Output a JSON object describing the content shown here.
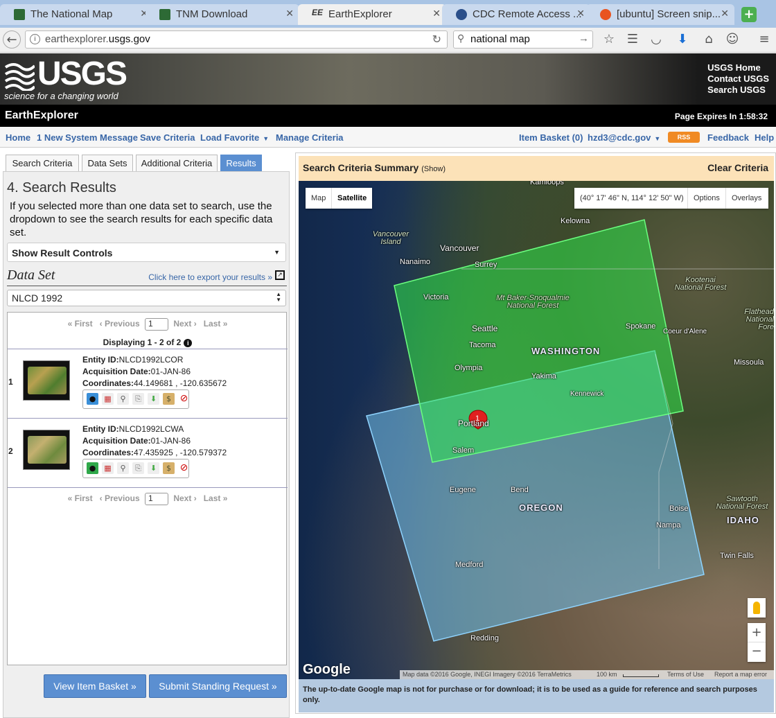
{
  "browser": {
    "tabs": [
      {
        "title": "The National Map",
        "active": false
      },
      {
        "title": "TNM Download",
        "active": false
      },
      {
        "title": "EarthExplorer",
        "active": true
      },
      {
        "title": "CDC Remote Access ...",
        "active": false
      },
      {
        "title": "[ubuntu] Screen snip...",
        "active": false
      }
    ],
    "url_host_prefix": "earthexplorer.",
    "url_host_domain": "usgs.gov",
    "search_value": "national map"
  },
  "usgs": {
    "logo_text": "USGS",
    "tagline": "science for a changing world",
    "links": [
      "USGS Home",
      "Contact USGS",
      "Search USGS"
    ]
  },
  "app": {
    "title": "EarthExplorer",
    "expires": "Page Expires In 1:58:32"
  },
  "menu": {
    "home": "Home",
    "system_message": "1 New System Message",
    "save_criteria": "Save Criteria",
    "load_favorite": "Load Favorite",
    "manage_criteria": "Manage Criteria",
    "item_basket": "Item Basket (0)",
    "user": "hzd3@cdc.gov",
    "rss": "RSS",
    "feedback": "Feedback",
    "help": "Help"
  },
  "left": {
    "tabs": [
      "Search Criteria",
      "Data Sets",
      "Additional Criteria",
      "Results"
    ],
    "active_tab": "Results",
    "title": "4. Search Results",
    "description": "If you selected more than one data set to search, use the dropdown to see the search results for each specific data set.",
    "result_controls": "Show Result Controls",
    "dataset_label": "Data Set",
    "export_link": "Click here to export your results »",
    "dataset_value": "NLCD 1992",
    "pager": {
      "first": "« First",
      "previous": "‹ Previous",
      "page": "1",
      "next": "Next ›",
      "last": "Last »"
    },
    "displaying": "Displaying 1 - 2 of 2",
    "results": [
      {
        "num": "1",
        "entity_label": "Entity ID:",
        "entity": "NLCD1992LCOR",
        "date_label": "Acquisition Date:",
        "date": "01-JAN-86",
        "coord_label": "Coordinates:",
        "coords": "44.149681 , -120.635672"
      },
      {
        "num": "2",
        "entity_label": "Entity ID:",
        "entity": "NLCD1992LCWA",
        "date_label": "Acquisition Date:",
        "date": "01-JAN-86",
        "coord_label": "Coordinates:",
        "coords": "47.435925 , -120.579372"
      }
    ],
    "btn_basket": "View Item Basket »",
    "btn_submit": "Submit Standing Request »"
  },
  "right": {
    "summary_title": "Search Criteria Summary",
    "summary_show": "(Show)",
    "clear": "Clear Criteria",
    "map_type_map": "Map",
    "map_type_satellite": "Satellite",
    "coords": "(40° 17' 46\" N, 114° 12' 50\" W)",
    "options": "Options",
    "overlays": "Overlays",
    "marker": "1",
    "labels": {
      "kamloops": "Kamloops",
      "kelowna": "Kelowna",
      "vancouver_island": "Vancouver Island",
      "vancouver": "Vancouver",
      "nanaimo": "Nanaimo",
      "surrey": "Surrey",
      "victoria": "Victoria",
      "baker": "Mt Baker-Snoqualmie National Forest",
      "seattle": "Seattle",
      "tacoma": "Tacoma",
      "olympia": "Olympia",
      "washington": "WASHINGTON",
      "spokane": "Spokane",
      "coeur": "Coeur d'Alene",
      "kootenai": "Kootenai National Forest",
      "flathead": "Flathead National Fore",
      "missoula": "Missoula",
      "yakima": "Yakima",
      "kennewick": "Kennewick",
      "portland": "Portland",
      "salem": "Salem",
      "eugene": "Eugene",
      "bend": "Bend",
      "oregon": "OREGON",
      "boise": "Boise",
      "nampa": "Nampa",
      "sawtooth": "Sawtooth National Forest",
      "idaho": "IDAHO",
      "twin_falls": "Twin Falls",
      "medford": "Medford",
      "redding": "Redding"
    },
    "google": "Google",
    "attribution": "Map data ©2016 Google, INEGI Imagery ©2016 TerraMetrics",
    "scale": "100 km",
    "terms": "Terms of Use",
    "report": "Report a map error",
    "note": "The up-to-date Google map is not for purchase or for download; it is to be used as a guide for reference and search purposes only."
  }
}
